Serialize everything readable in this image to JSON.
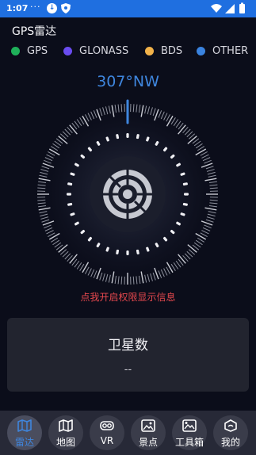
{
  "status_bar": {
    "time": "1:07",
    "overflow": "···",
    "download_icon": "download-circle-icon",
    "shield_icon": "shield-icon",
    "wifi_icon": "wifi-icon",
    "signal_icon": "cell-signal-icon",
    "battery_icon": "battery-icon"
  },
  "app": {
    "title": "GPS雷达"
  },
  "legend": [
    {
      "label": "GPS",
      "color": "#1fb05a"
    },
    {
      "label": "GLONASS",
      "color": "#6a4cf0"
    },
    {
      "label": "BDS",
      "color": "#f2b24a"
    },
    {
      "label": "OTHER",
      "color": "#3a83e0"
    }
  ],
  "compass": {
    "heading": "307°NW",
    "accent_color": "#3f86de"
  },
  "permission": {
    "hint": "点我开启权限显示信息",
    "color": "#e5484d"
  },
  "satellites": {
    "title": "卫星数",
    "value": "--"
  },
  "nav": {
    "items": [
      {
        "label": "雷达",
        "icon": "radar-map-icon",
        "active": true
      },
      {
        "label": "地图",
        "icon": "map-icon",
        "active": false
      },
      {
        "label": "VR",
        "icon": "vr-goggles-icon",
        "active": false
      },
      {
        "label": "景点",
        "icon": "landscape-photo-icon",
        "active": false
      },
      {
        "label": "工具箱",
        "icon": "toolbox-image-icon",
        "active": false
      },
      {
        "label": "我的",
        "icon": "profile-icon",
        "active": false
      }
    ]
  }
}
